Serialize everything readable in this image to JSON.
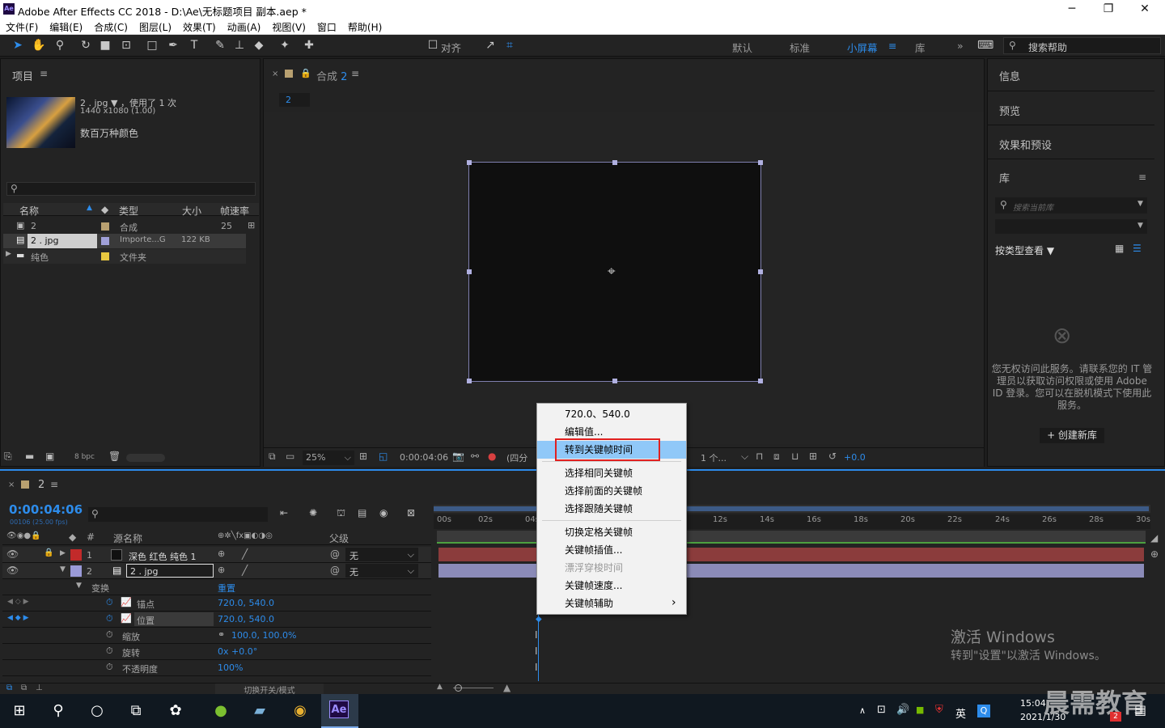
{
  "window": {
    "title": "Adobe After Effects CC 2018 - D:\\Ae\\无标题项目 副本.aep *",
    "logo": "Ae",
    "min": "─",
    "max": "❐",
    "close": "✕"
  },
  "menu": [
    "文件(F)",
    "编辑(E)",
    "合成(C)",
    "图层(L)",
    "效果(T)",
    "动画(A)",
    "视图(V)",
    "窗口",
    "帮助(H)"
  ],
  "toolbar": {
    "align_label": "对齐",
    "workspaces": [
      "默认",
      "标准",
      "小屏幕",
      "库"
    ],
    "search_placeholder": "搜索帮助"
  },
  "project": {
    "title": "项目",
    "file_name": "2 . jpg",
    "usage": "，使用了 1 次",
    "dimensions": "1440 x1080 (1.00)",
    "color_info": "数百万种颜色",
    "columns": [
      "名称",
      "类型",
      "大小",
      "帧速率"
    ],
    "rows": [
      {
        "name": "2",
        "type": "合成",
        "size": "",
        "fps": "25"
      },
      {
        "name": "2 . jpg",
        "type": "Importe...G",
        "size": "122 KB",
        "fps": ""
      },
      {
        "name": "纯色",
        "type": "文件夹",
        "size": "",
        "fps": ""
      }
    ],
    "bpc": "8 bpc"
  },
  "comp": {
    "tab": "合成",
    "tab_num": "2",
    "breadcrumb": "2",
    "zoom": "25%",
    "timecode": "0:00:04:06",
    "quarter": "(四分",
    "view": "1 个...",
    "exposure": "+0.0"
  },
  "right": {
    "panels": [
      "信息",
      "预览",
      "效果和预设",
      "库"
    ],
    "search_placeholder": "搜索当前库",
    "view_by": "按类型查看",
    "message": "您无权访问此服务。请联系您的 IT 管理员以获取访问权限或使用 Adobe ID 登录。您可以在脱机模式下使用此服务。",
    "create_button": "+ 创建新库"
  },
  "timeline": {
    "tab": "2",
    "timecode": "0:00:04:06",
    "timecode_sub": "00106 (25.00 fps)",
    "columns": [
      "#",
      "源名称",
      "父级"
    ],
    "layers": [
      {
        "num": "1",
        "name": "深色 红色 纯色 1",
        "parent": "无",
        "color": "#c22a2a"
      },
      {
        "num": "2",
        "name": "2 . jpg",
        "parent": "无",
        "color": "#9a9ad8"
      }
    ],
    "transform": "变换",
    "reset": "重置",
    "props": [
      {
        "name": "锚点",
        "value": "720.0, 540.0"
      },
      {
        "name": "位置",
        "value": "720.0, 540.0"
      },
      {
        "name": "缩放",
        "value": "100.0, 100.0%"
      },
      {
        "name": "旋转",
        "value": "0x +0.0°"
      },
      {
        "name": "不透明度",
        "value": "100%"
      }
    ],
    "ruler": [
      "00s",
      "02s",
      "04s",
      "12s",
      "14s",
      "16s",
      "18s",
      "20s",
      "22s",
      "24s",
      "26s",
      "28s",
      "30s"
    ],
    "toggle_label": "切换开关/模式"
  },
  "context_menu": {
    "items": [
      "720.0、540.0",
      "编辑值...",
      "转到关键帧时间",
      "选择相同关键帧",
      "选择前面的关键帧",
      "选择跟随关键帧",
      "切换定格关键帧",
      "关键帧插值...",
      "漂浮穿梭时间",
      "关键帧速度...",
      "关键帧辅助"
    ],
    "submenu_arrow": "›"
  },
  "watermark": {
    "line1": "激活 Windows",
    "line2": "转到\"设置\"以激活 Windows。",
    "brand": "晨需教育"
  },
  "taskbar": {
    "time": "15:04",
    "date": "2021/1/30",
    "ime": "英",
    "notif": "2"
  }
}
